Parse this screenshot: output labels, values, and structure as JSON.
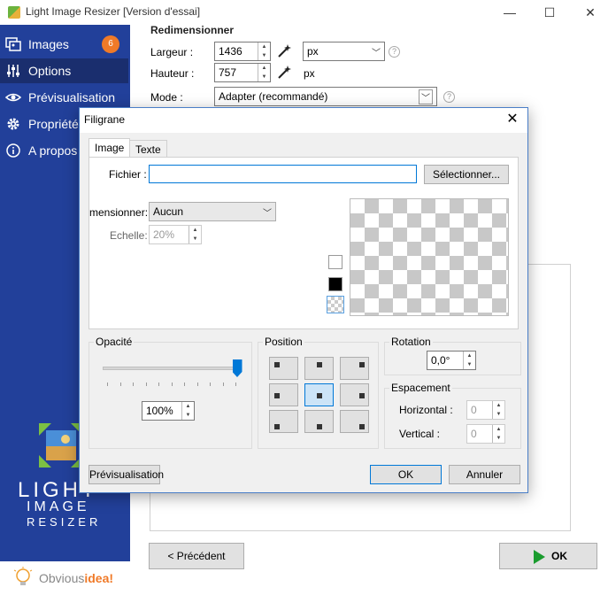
{
  "window": {
    "title": "Light Image Resizer  [Version d'essai]",
    "controls": {
      "minimize": "—",
      "maximize": "☐",
      "close": "✕"
    }
  },
  "sidebar": {
    "items": [
      {
        "label": "Images",
        "icon": "images-icon",
        "badge": "6"
      },
      {
        "label": "Options",
        "icon": "sliders-icon",
        "active": true
      },
      {
        "label": "Prévisualisation",
        "icon": "eye-icon"
      },
      {
        "label": "Propriétés",
        "icon": "gear-icon"
      },
      {
        "label": "A propos",
        "icon": "info-icon"
      }
    ],
    "logo": {
      "line1": "LIGHT",
      "line2": "IMAGE",
      "line3": "RESIZER"
    },
    "brand": {
      "part1": "Obvious",
      "part2": "idea!"
    }
  },
  "main": {
    "section_title": "Redimensionner",
    "width": {
      "label": "Largeur :",
      "value": "1436",
      "unit": "px"
    },
    "height": {
      "label": "Hauteur :",
      "value": "757",
      "unit": "px"
    },
    "mode": {
      "label": "Mode :",
      "value": "Adapter (recommandé)"
    },
    "help": "?",
    "prev_button": "< Précédent",
    "ok_button": "OK"
  },
  "dialog": {
    "title": "Filigrane",
    "close": "✕",
    "tabs": [
      "Image",
      "Texte"
    ],
    "file": {
      "label": "Fichier :",
      "value": "",
      "button": "Sélectionner..."
    },
    "resize": {
      "label": "mensionner:",
      "value": "Aucun"
    },
    "scale": {
      "label": "Echelle:",
      "value": "20%"
    },
    "opacity": {
      "title": "Opacité",
      "value": "100%",
      "level": 1.0
    },
    "position": {
      "title": "Position",
      "selected": "center"
    },
    "rotation": {
      "title": "Rotation",
      "value": "0,0°"
    },
    "spacing": {
      "title": "Espacement",
      "horizontal_label": "Horizontal :",
      "horizontal_value": "0",
      "vertical_label": "Vertical :",
      "vertical_value": "0"
    },
    "buttons": {
      "preview": "Prévisualisation",
      "ok": "OK",
      "cancel": "Annuler"
    }
  },
  "colors": {
    "sidebar": "#22409a",
    "active_nav": "#1a2e6e",
    "badge": "#f07a28",
    "accent": "#0078d7"
  }
}
